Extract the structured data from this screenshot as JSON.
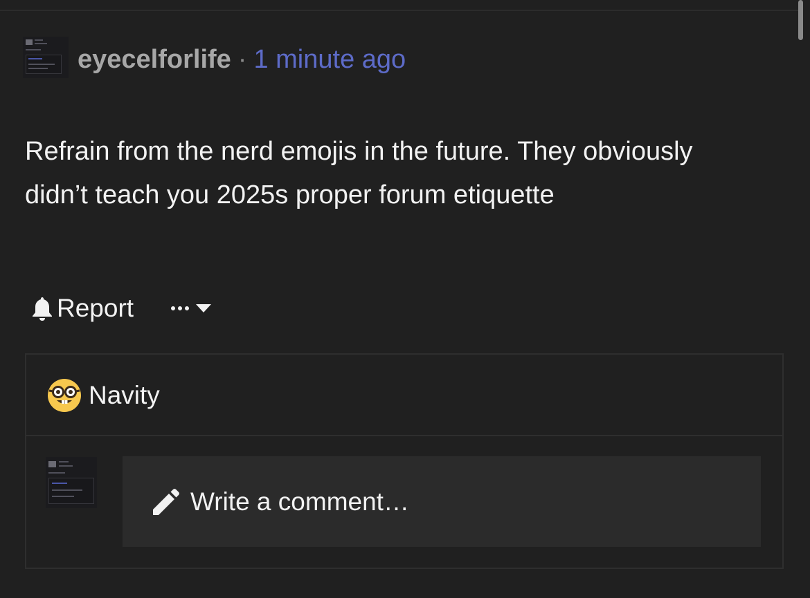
{
  "post": {
    "username": "eyecelforlife",
    "separator": "·",
    "timestamp": "1 minute ago",
    "body": "Refrain from the nerd emojis in the future. They obviously didn’t teach you 2025s proper forum etiquette"
  },
  "actions": {
    "report_label": "Report",
    "more_icon": "ellipsis-icon",
    "dropdown_icon": "caret-down-icon"
  },
  "reactions": [
    {
      "emoji": "nerd-face-icon",
      "name": "Navity"
    }
  ],
  "comment": {
    "placeholder": "Write a comment…",
    "icon": "pencil-icon"
  },
  "colors": {
    "background": "#202020",
    "username": "#a7a7a7",
    "timestamp": "#5d6bc8",
    "text": "#f2f2f2",
    "input_bg": "#2b2b2b"
  }
}
